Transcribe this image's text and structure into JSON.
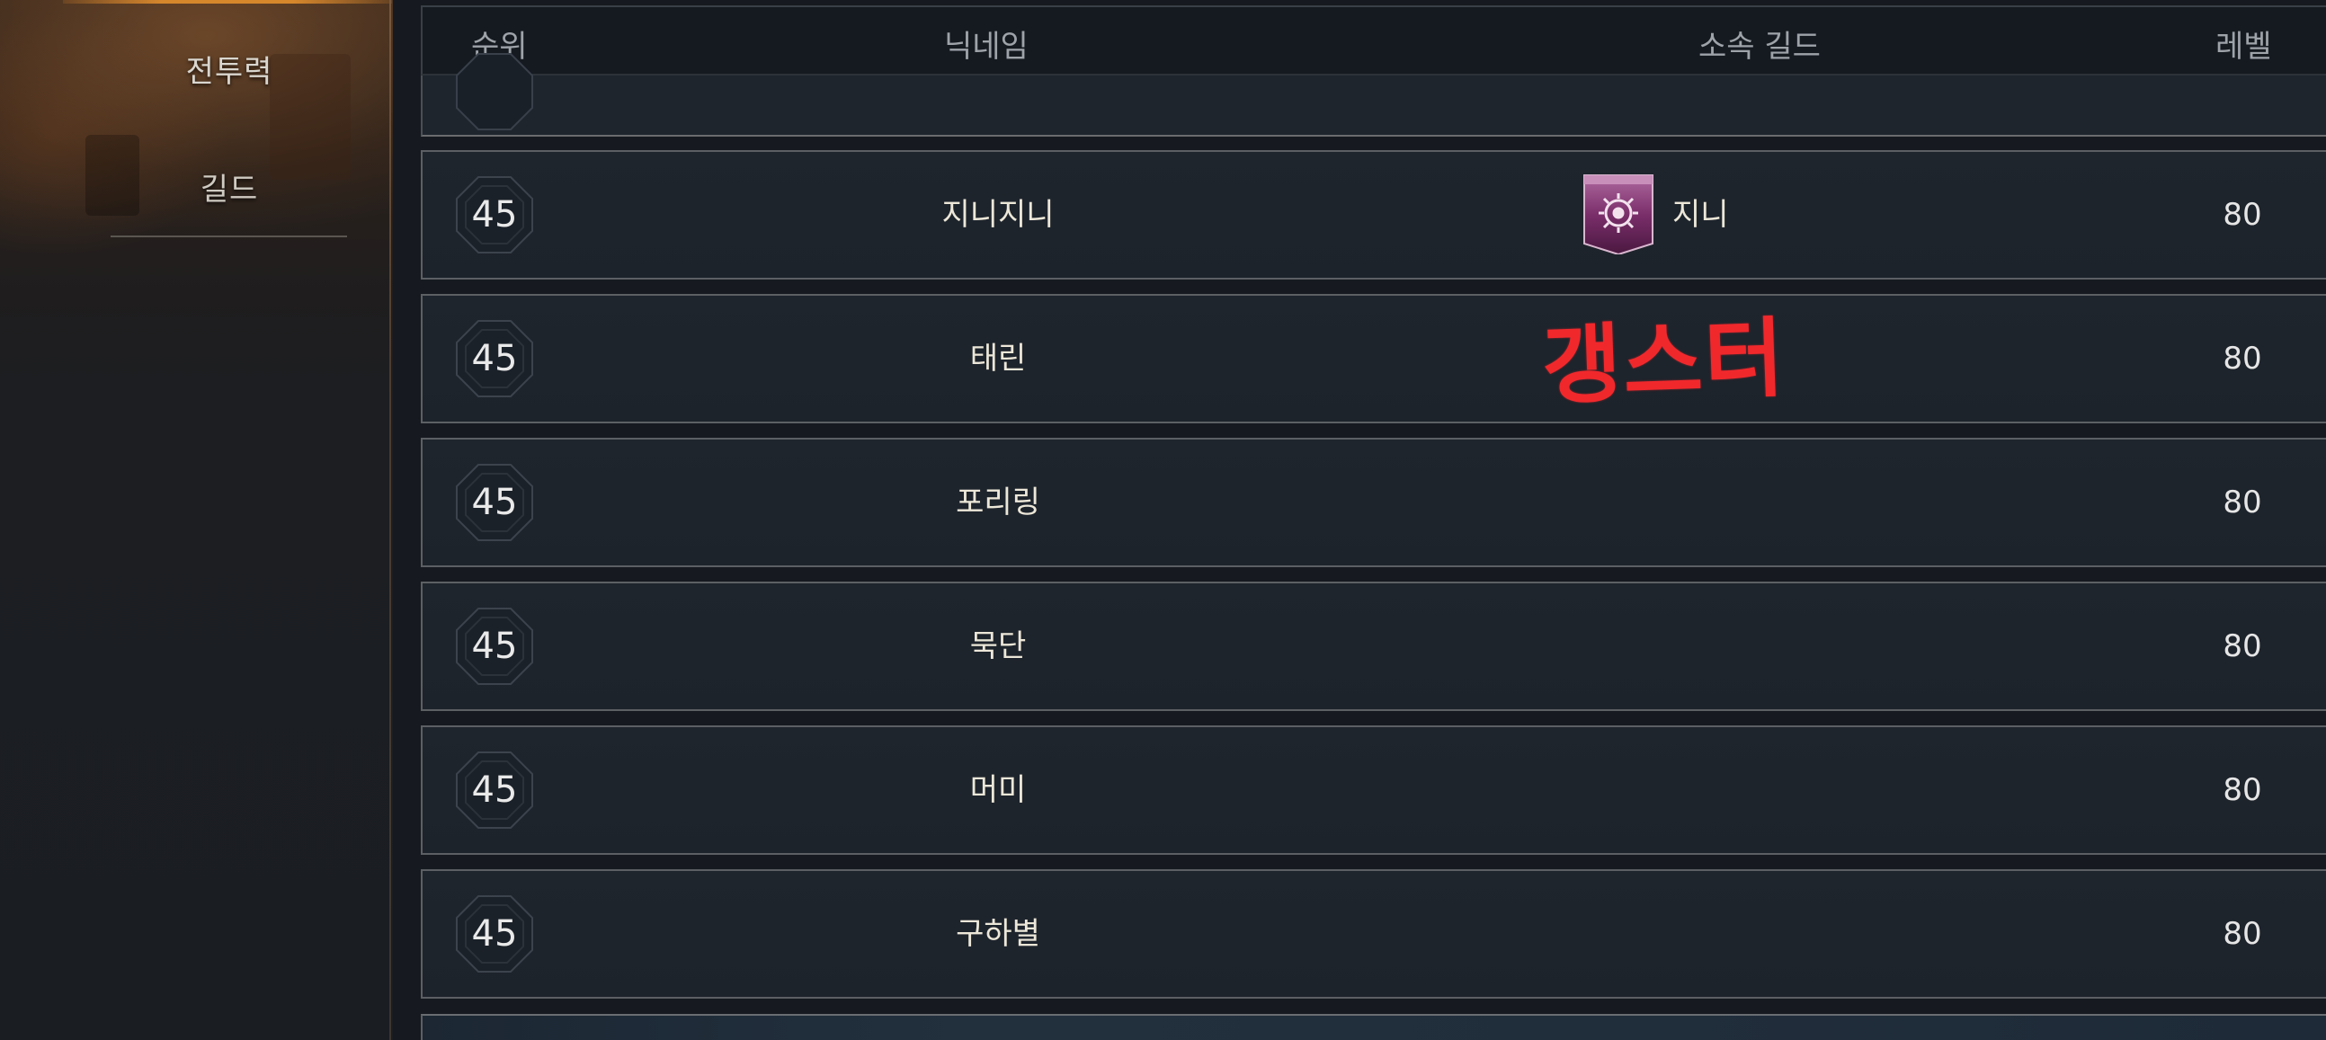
{
  "sidebar": {
    "items": [
      {
        "label": "전투력"
      },
      {
        "label": "길드"
      }
    ]
  },
  "table": {
    "headers": {
      "rank": "순위",
      "nickname": "닉네임",
      "guild": "소속 길드",
      "level": "레벨"
    },
    "rows": [
      {
        "rank": "45",
        "nickname": "지니지니",
        "guild": "지니",
        "guild_emblem": "guild-emblem-icon",
        "level": "80"
      },
      {
        "rank": "45",
        "nickname": "태린",
        "guild": "",
        "level": "80"
      },
      {
        "rank": "45",
        "nickname": "포리링",
        "guild": "",
        "level": "80"
      },
      {
        "rank": "45",
        "nickname": "묵단",
        "guild": "",
        "level": "80"
      },
      {
        "rank": "45",
        "nickname": "머미",
        "guild": "",
        "level": "80"
      },
      {
        "rank": "45",
        "nickname": "구하별",
        "guild": "",
        "level": "80"
      }
    ]
  },
  "annotation": {
    "text": "갱스터",
    "color": "#f0282c"
  },
  "colors": {
    "accent": "#d6872c",
    "row_bg": "#1f252d",
    "row_border": "#5c6064",
    "text_light": "#ece7d8"
  }
}
